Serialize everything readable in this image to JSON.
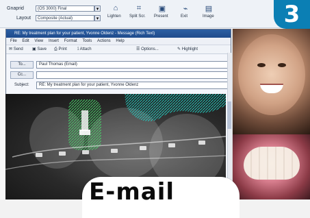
{
  "top_toolbar": {
    "row1_label": "Gnaprid",
    "row1_value": "(OS 3000) Final",
    "row2_label": "Layout",
    "row2_value": "Composite (Actual)",
    "icons": [
      {
        "name": "lighten-icon",
        "label": "Lighten",
        "glyph": "⌂"
      },
      {
        "name": "split-screen-icon",
        "label": "Split Scr.",
        "glyph": "⌗"
      },
      {
        "name": "present-icon",
        "label": "Present",
        "glyph": "▣"
      },
      {
        "name": "exit-icon",
        "label": "Exit",
        "glyph": "⌁"
      },
      {
        "name": "image-icon",
        "label": "Image",
        "glyph": "▤"
      }
    ]
  },
  "badge": {
    "number": "3"
  },
  "email": {
    "window_title": "RE: My treatment plan for your patient, Yvonne Oldenz - Message (Rich Text)",
    "menu": [
      "File",
      "Edit",
      "View",
      "Insert",
      "Format",
      "Tools",
      "Actions",
      "Help"
    ],
    "toolbar_items": [
      "Send",
      "Save",
      "Print",
      "Attach",
      "Options...",
      "Highlight"
    ],
    "to_label": "To...",
    "to_value": "Paul Thomas (Email)",
    "cc_label": "Cc...",
    "cc_value": "",
    "subject_label": "Subject:",
    "subject_value": "RE: My treatment plan for your patient, Yvonne Oldenz"
  },
  "sticker": {
    "text": "E-mail"
  }
}
